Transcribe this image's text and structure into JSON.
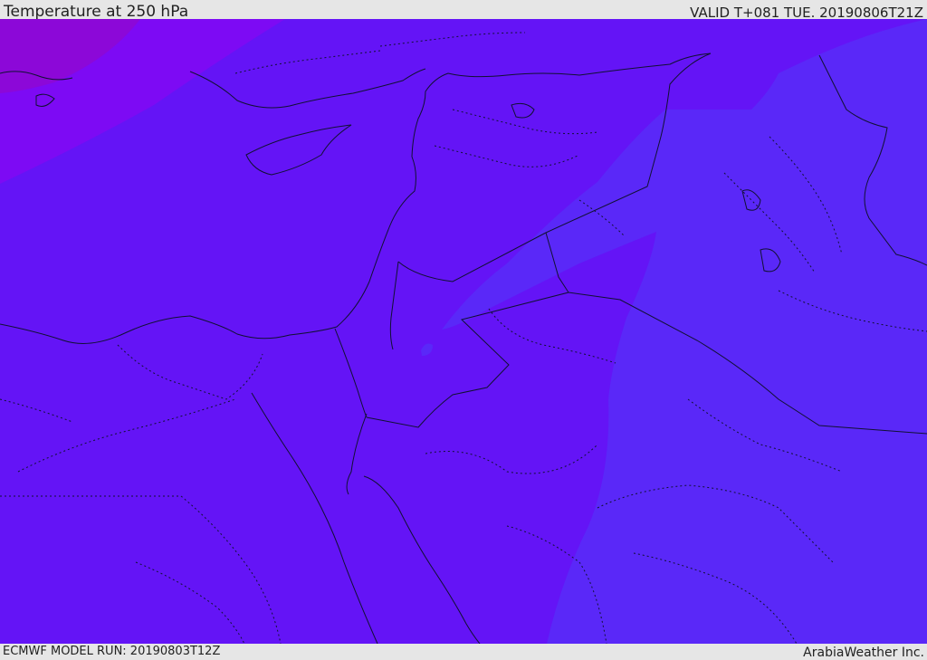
{
  "header": {
    "title": "Temperature at 250 hPa",
    "valid": "VALID T+081 TUE. 20190806T21Z"
  },
  "footer": {
    "model_run": "ECMWF MODEL RUN: 20190803T12Z",
    "credit": "ArabiaWeather Inc."
  },
  "map": {
    "colors": {
      "base_field": "#6414f6",
      "warm_band": "#7d0af4",
      "warmest_band": "#8c08d8",
      "cool_band": "#5a28f8",
      "border": "#111133"
    }
  }
}
